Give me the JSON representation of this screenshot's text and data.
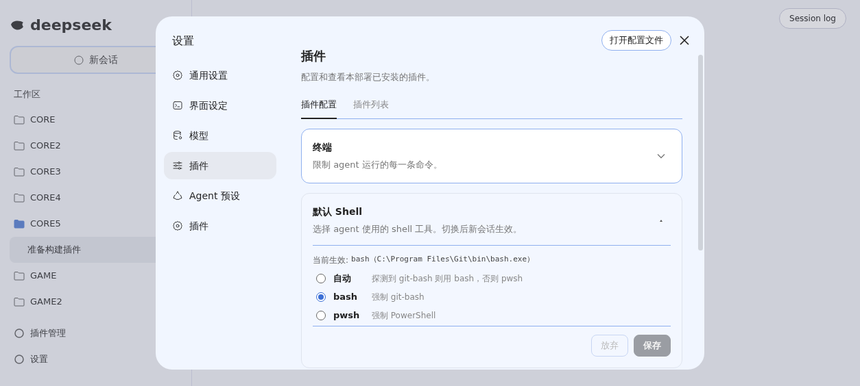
{
  "background": {
    "brand": "deepseek",
    "new_chat": "新会话",
    "workspace_label": "工作区",
    "folders": [
      {
        "name": "CORE",
        "expanded": false
      },
      {
        "name": "CORE2",
        "expanded": false
      },
      {
        "name": "CORE3",
        "expanded": false
      },
      {
        "name": "CORE4",
        "expanded": false
      },
      {
        "name": "CORE5",
        "expanded": true,
        "children": [
          {
            "name": "准备构建插件"
          }
        ]
      },
      {
        "name": "GAME",
        "expanded": false
      },
      {
        "name": "GAME2",
        "expanded": false
      }
    ],
    "footer": [
      "插件管理",
      "设置"
    ],
    "session_log": "Session log"
  },
  "dialog": {
    "title": "设置",
    "open_config": "打开配置文件",
    "nav": [
      {
        "label": "通用设置",
        "selected": false
      },
      {
        "label": "界面设定",
        "selected": false
      },
      {
        "label": "模型",
        "selected": false
      },
      {
        "label": "插件",
        "selected": true
      },
      {
        "label": "Agent 预设",
        "selected": false
      },
      {
        "label": "插件",
        "selected": false
      }
    ],
    "heading": "插件",
    "subtitle": "配置和查看本部署已安装的插件。",
    "tabs": [
      {
        "label": "插件配置",
        "selected": true
      },
      {
        "label": "插件列表",
        "selected": false
      }
    ],
    "panels": [
      {
        "title": "终端",
        "description": "限制 agent 运行的每一条命令。",
        "expanded": false
      },
      {
        "title": "默认 Shell",
        "description": "选择 agent 使用的 shell 工具。切换后新会话生效。",
        "expanded": true,
        "current_label": "当前生效:",
        "current_value": "bash（C:\\Program Files\\Git\\bin\\bash.exe）",
        "options": [
          {
            "name": "自动",
            "hint": "探测到 git-bash 则用 bash，否则 pwsh",
            "selected": false
          },
          {
            "name": "bash",
            "hint": "强制 git-bash",
            "selected": true
          },
          {
            "name": "pwsh",
            "hint": "强制 PowerShell",
            "selected": false
          }
        ],
        "buttons": [
          {
            "label": "放弃",
            "kind": "outline",
            "disabled": true
          },
          {
            "label": "保存",
            "kind": "primary",
            "disabled": true
          }
        ]
      }
    ]
  }
}
